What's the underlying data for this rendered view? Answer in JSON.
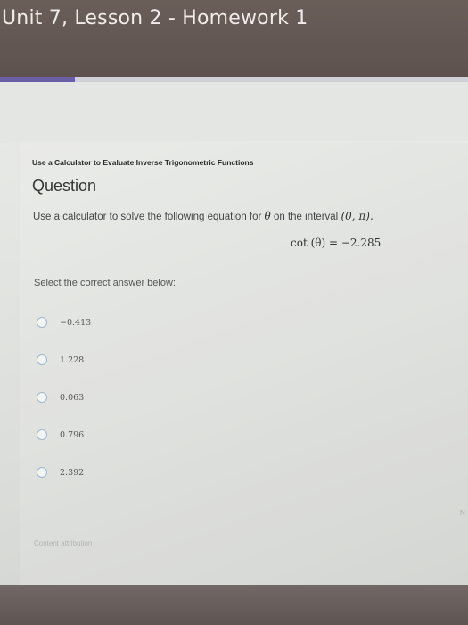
{
  "header": {
    "title": "Unit 7, Lesson 2 - Homework 1",
    "progress": 0.16
  },
  "question": {
    "skill": "Use a Calculator to Evaluate Inverse Trigonometric Functions",
    "heading": "Question",
    "text_before": "Use a calculator to solve the following equation for",
    "variable": "θ",
    "text_after": "on the interval",
    "interval": "(0, π).",
    "equation_lhs": "cot (θ)",
    "equation_rhs": "= −2.285",
    "prompt": "Select the correct answer below:"
  },
  "options": [
    "−0.413",
    "1.228",
    "0.063",
    "0.796",
    "2.392"
  ],
  "footer": {
    "attribution": "Content attribution",
    "edge_letter": "N"
  },
  "colors": {
    "progress": "#6b5ea8",
    "radio_border": "#9fb8c8"
  }
}
